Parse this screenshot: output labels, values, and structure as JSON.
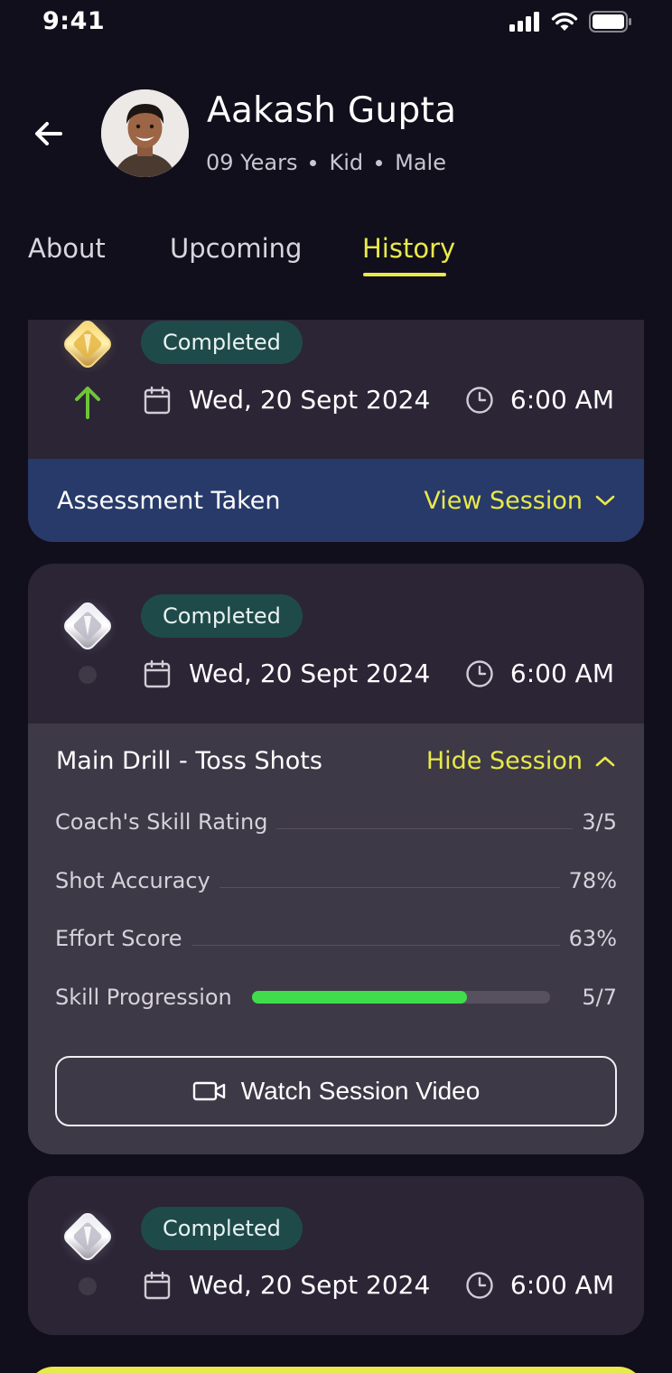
{
  "status_bar": {
    "time": "9:41"
  },
  "profile": {
    "name": "Aakash Gupta",
    "age": "09 Years",
    "category": "Kid",
    "gender": "Male"
  },
  "tabs": [
    {
      "label": "About",
      "active": false
    },
    {
      "label": "Upcoming",
      "active": false
    },
    {
      "label": "History",
      "active": true
    }
  ],
  "sessions": [
    {
      "status": "Completed",
      "date": "Wed, 20 Sept 2024",
      "time": "6:00 AM",
      "badge": "gold-diamond",
      "trend": "up",
      "footer_title": "Assessment Taken",
      "action": "View Session"
    },
    {
      "status": "Completed",
      "date": "Wed, 20 Sept 2024",
      "time": "6:00 AM",
      "badge": "silver-diamond",
      "detail_title": "Main Drill - Toss Shots",
      "action": "Hide Session",
      "metrics": [
        {
          "label": "Coach's Skill Rating",
          "value": "3/5"
        },
        {
          "label": "Shot Accuracy",
          "value": "78%"
        },
        {
          "label": "Effort Score",
          "value": "63%"
        },
        {
          "label": "Skill Progression",
          "value": "5/7",
          "progress": 0.72
        }
      ],
      "video_button": "Watch Session Video"
    },
    {
      "status": "Completed",
      "date": "Wed, 20 Sept 2024",
      "time": "6:00 AM",
      "badge": "silver-diamond"
    }
  ],
  "colors": {
    "background": "#120f1c",
    "card": "#2b2536",
    "accent": "#e8e94a",
    "status_pill": "#1f4a4a",
    "assessment_footer": "#283a6a",
    "progress": "#3fdd4c"
  }
}
